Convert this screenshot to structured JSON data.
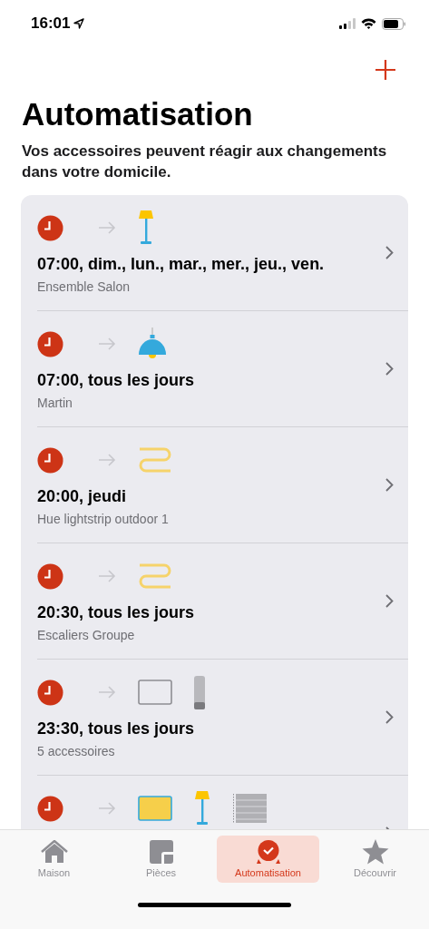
{
  "status_bar": {
    "time": "16:01"
  },
  "title": "Automatisation",
  "subtitle": "Vos accessoires peuvent réagir aux changements dans votre domicile.",
  "automations": [
    {
      "title": "07:00, dim., lun., mar., mer., jeu., ven.",
      "subtitle": "Ensemble Salon",
      "devices": [
        {
          "kind": "floor-lamp"
        }
      ]
    },
    {
      "title": "07:00, tous les jours",
      "subtitle": "Martin",
      "devices": [
        {
          "kind": "pendant-lamp"
        }
      ]
    },
    {
      "title": "20:00, jeudi",
      "subtitle": "Hue lightstrip outdoor 1",
      "devices": [
        {
          "kind": "lightstrip"
        }
      ]
    },
    {
      "title": "20:30, tous les jours",
      "subtitle": "Escaliers Groupe",
      "devices": [
        {
          "kind": "lightstrip"
        }
      ]
    },
    {
      "title": "23:30, tous les jours",
      "subtitle": "5 accessoires",
      "devices": [
        {
          "kind": "panel-off"
        },
        {
          "kind": "speaker"
        }
      ]
    },
    {
      "devices": [
        {
          "kind": "panel-on"
        },
        {
          "kind": "floor-lamp"
        },
        {
          "kind": "blinds"
        }
      ]
    }
  ],
  "tabs": [
    {
      "label": "Maison",
      "kind": "house",
      "selected": false
    },
    {
      "label": "Pièces",
      "kind": "rooms",
      "selected": false
    },
    {
      "label": "Automatisation",
      "kind": "clock",
      "selected": true
    },
    {
      "label": "Découvrir",
      "kind": "star",
      "selected": false
    }
  ]
}
